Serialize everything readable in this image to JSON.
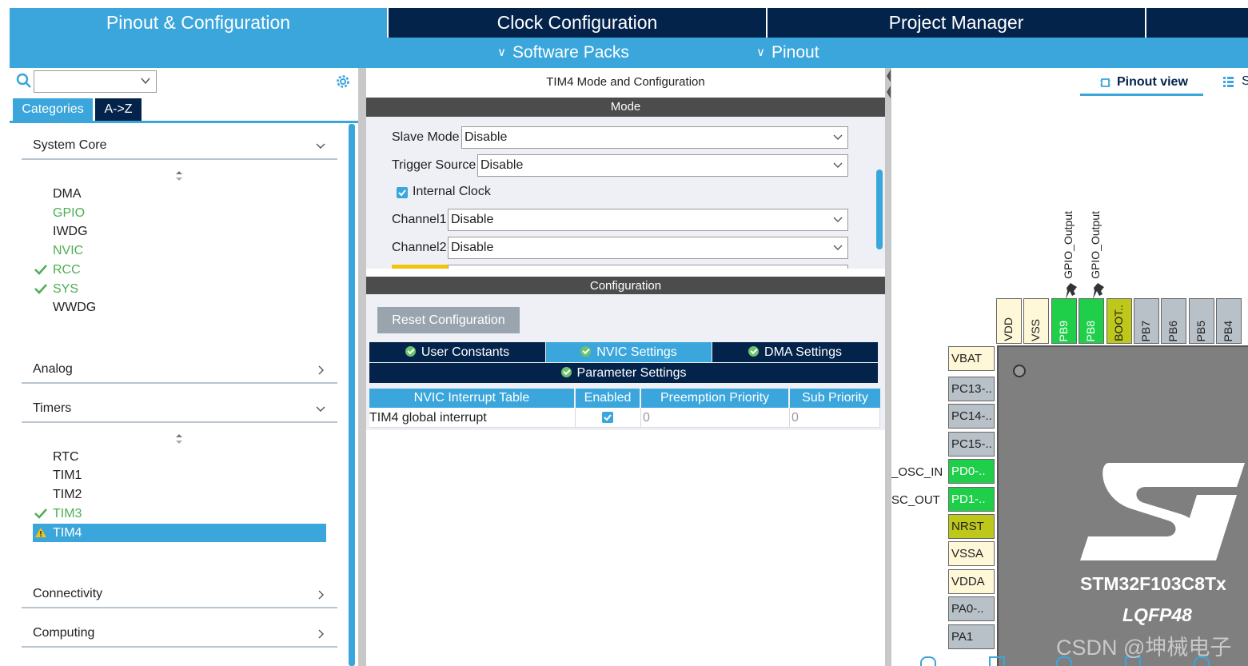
{
  "tabs": {
    "pinout_config": "Pinout & Configuration",
    "clock_config": "Clock Configuration",
    "project_manager": "Project Manager"
  },
  "submenu": {
    "software_packs": "Software Packs",
    "pinout": "Pinout"
  },
  "left": {
    "tab_categories": "Categories",
    "tab_az": "A->Z",
    "groups": {
      "system_core": "System Core",
      "analog": "Analog",
      "timers": "Timers",
      "connectivity": "Connectivity",
      "computing": "Computing"
    },
    "system_core_items": [
      "DMA",
      "GPIO",
      "IWDG",
      "NVIC",
      "RCC",
      "SYS",
      "WWDG"
    ],
    "timers_items": [
      "RTC",
      "TIM1",
      "TIM2",
      "TIM3",
      "TIM4"
    ]
  },
  "middle": {
    "title": "TIM4 Mode and Configuration",
    "mode_header": "Mode",
    "slave_mode_label": "Slave Mode",
    "slave_mode_value": "Disable",
    "trigger_source_label": "Trigger Source",
    "trigger_source_value": "Disable",
    "internal_clock_label": "Internal Clock",
    "internal_clock_checked": true,
    "channel1_label": "Channel1",
    "channel1_value": "Disable",
    "channel2_label": "Channel2",
    "channel2_value": "Disable",
    "config_header": "Configuration",
    "reset_button": "Reset Configuration",
    "config_tabs": {
      "user_constants": "User Constants",
      "nvic_settings": "NVIC Settings",
      "dma_settings": "DMA Settings",
      "parameter_settings": "Parameter Settings"
    },
    "nvic_table": {
      "headers": [
        "NVIC Interrupt Table",
        "Enabled",
        "Preemption Priority",
        "Sub Priority"
      ],
      "rows": [
        {
          "name": "TIM4 global interrupt",
          "enabled": true,
          "preemption": "0",
          "sub": "0"
        }
      ]
    }
  },
  "right": {
    "pinout_view_tab": "Pinout view",
    "system_view_tab": "S",
    "top_pins": [
      "VDD",
      "VSS",
      "PB9",
      "PB8",
      "BOOT..",
      "PB7",
      "PB6",
      "PB5",
      "PB4"
    ],
    "top_signals": [
      "GPIO_Output",
      "GPIO_Output"
    ],
    "left_pins": [
      "VBAT",
      "PC13-..",
      "PC14-..",
      "PC15-..",
      "PD0-..",
      "PD1-..",
      "NRST",
      "VSSA",
      "VDDA",
      "PA0-..",
      "PA1"
    ],
    "left_signals": [
      "_OSC_IN",
      "SC_OUT"
    ],
    "chip_name": "STM32F103C8Tx",
    "chip_package": "LQFP48",
    "watermark": "CSDN @坤械电子"
  },
  "colors": {
    "accent": "#3ba6dc",
    "navy": "#03234b",
    "pin_green": "#1fcf4a",
    "pin_olive": "#bec81a",
    "pin_beige": "#fef7d8",
    "pin_gray": "#b8c0c8",
    "chip_gray": "#7f7f7f"
  }
}
